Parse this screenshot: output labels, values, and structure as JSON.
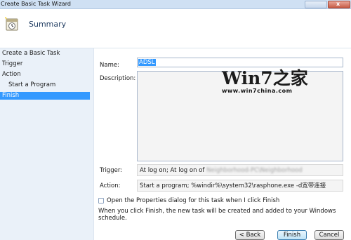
{
  "window": {
    "title": "Create Basic Task Wizard",
    "close_glyph": "x"
  },
  "header": {
    "title": "Summary",
    "icon": "task-scheduler-icon"
  },
  "steps": [
    {
      "label": "Create a Basic Task",
      "sub": false,
      "active": false
    },
    {
      "label": "Trigger",
      "sub": false,
      "active": false
    },
    {
      "label": "Action",
      "sub": false,
      "active": false
    },
    {
      "label": "Start a Program",
      "sub": true,
      "active": false
    },
    {
      "label": "Finish",
      "sub": false,
      "active": true
    }
  ],
  "form": {
    "name_label": "Name:",
    "name_value": "ADSL",
    "description_label": "Description:",
    "description_value": "",
    "trigger_label": "Trigger:",
    "trigger_value": "At log on; At log on of",
    "trigger_user_redacted": "Neighborhood-PC\\Neighborhood",
    "action_label": "Action:",
    "action_value": "Start a program; %windir%\\system32\\rasphone.exe -d宽带连接"
  },
  "watermark": {
    "brand": "Win7之家",
    "url": "www.win7china.com"
  },
  "options": {
    "open_properties_label": "Open the Properties dialog for this task when I click Finish",
    "open_properties_checked": false,
    "finish_info": "When you click Finish, the new task will be created and added to your Windows schedule."
  },
  "buttons": {
    "back": "< Back",
    "finish": "Finish",
    "cancel": "Cancel"
  },
  "colors": {
    "accent": "#3399ff",
    "left_pane": "#eaf1f9",
    "titlebar": "#cfe0f3"
  }
}
